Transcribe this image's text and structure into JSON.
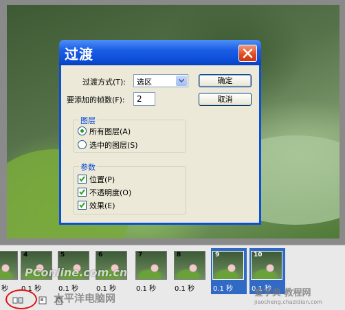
{
  "dialog": {
    "title": "过渡",
    "method_label": "过渡方式(T):",
    "method_value": "选区",
    "frames_label": "要添加的帧数(F):",
    "frames_value": "2",
    "ok_label": "确定",
    "cancel_label": "取消",
    "layers": {
      "title": "图层",
      "all_layers": "所有图层(A)",
      "selected_layers": "选中的图层(S)",
      "selected": "all_layers"
    },
    "params": {
      "title": "参数",
      "position": "位置(P)",
      "opacity": "不透明度(O)",
      "effects": "效果(E)",
      "position_checked": true,
      "opacity_checked": true,
      "effects_checked": true
    }
  },
  "frames": [
    {
      "num": "",
      "delay": "秒"
    },
    {
      "num": "4",
      "delay": "0.1 秒"
    },
    {
      "num": "5",
      "delay": "0.1 秒"
    },
    {
      "num": "6",
      "delay": "0.1 秒"
    },
    {
      "num": "7",
      "delay": "0.1 秒"
    },
    {
      "num": "8",
      "delay": "0.1 秒"
    },
    {
      "num": "9",
      "delay": "0.1 秒"
    },
    {
      "num": "10",
      "delay": "0.1 秒"
    }
  ],
  "watermarks": {
    "left": "PConline.com.cn",
    "left_sub": "太平洋电脑网",
    "right": "查字典 教程网",
    "right_sub": "jiaocheng.chazidian.com"
  },
  "colors": {
    "selection": "#316ac5",
    "title_bar": "#0a4bd6",
    "highlight_ring": "#e01010"
  }
}
